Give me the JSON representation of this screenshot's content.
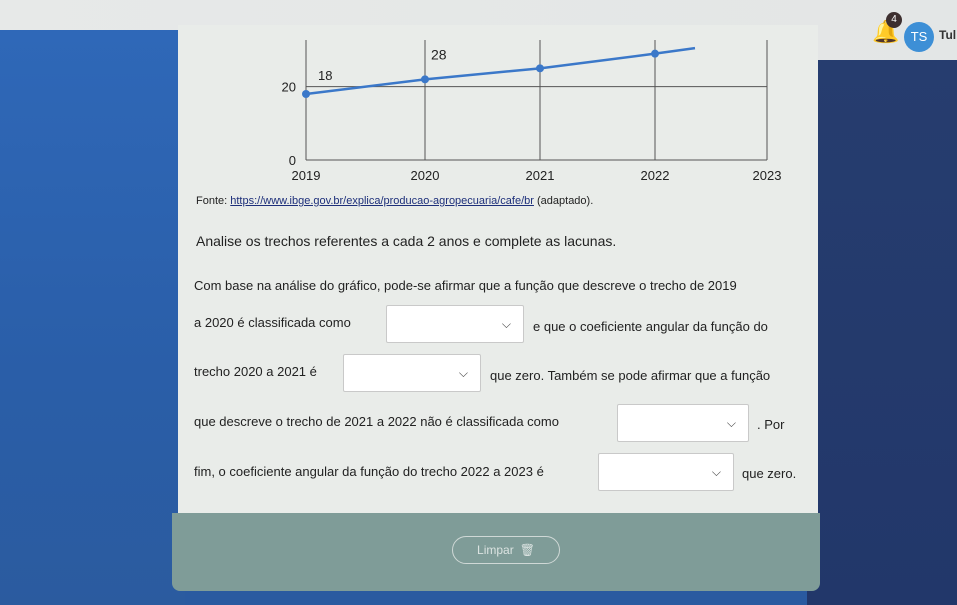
{
  "header": {
    "notification_count": "4",
    "avatar_initials": "TS",
    "user_name": "Tul"
  },
  "chart_data": {
    "type": "line",
    "x": [
      "2019",
      "2020",
      "2021",
      "2022",
      "2023"
    ],
    "tick_labels_x": [
      "2019",
      "2020",
      "2021",
      "2022",
      "2023"
    ],
    "tick_labels_y": [
      "0",
      "20"
    ],
    "data_labels": [
      "18",
      "28"
    ],
    "series": [
      {
        "values": [
          18,
          22,
          25,
          29,
          null
        ],
        "color": "#3b78c9"
      }
    ],
    "ylim": [
      0,
      30
    ],
    "grid": true
  },
  "source": {
    "prefix": "Fonte:",
    "link": "https://www.ibge.gov.br/explica/producao-agropecuaria/cafe/br",
    "suffix": "(adaptado)."
  },
  "instruction": "Analise os trechos referentes a cada 2 anos e complete as lacunas.",
  "paragraph": {
    "line1": "Com base na análise do gráfico, pode-se afirmar que a função que descreve o trecho de 2019",
    "line2a": "a 2020 é classificada como",
    "line2b": "e que o coeficiente angular da função do",
    "line3a": "trecho 2020 a 2021 é",
    "line3b": "que zero. Também se pode afirmar que a função",
    "line4a": "que descreve o trecho de 2021 a 2022 não é classificada como",
    "line4b": ". Por",
    "line5a": "fim, o coeficiente angular da função do trecho 2022 a 2023 é",
    "line5b": "que zero."
  },
  "dropdowns": {
    "d1": "",
    "d2": "",
    "d3": "",
    "d4": ""
  },
  "footer": {
    "clear_label": "Limpar"
  }
}
